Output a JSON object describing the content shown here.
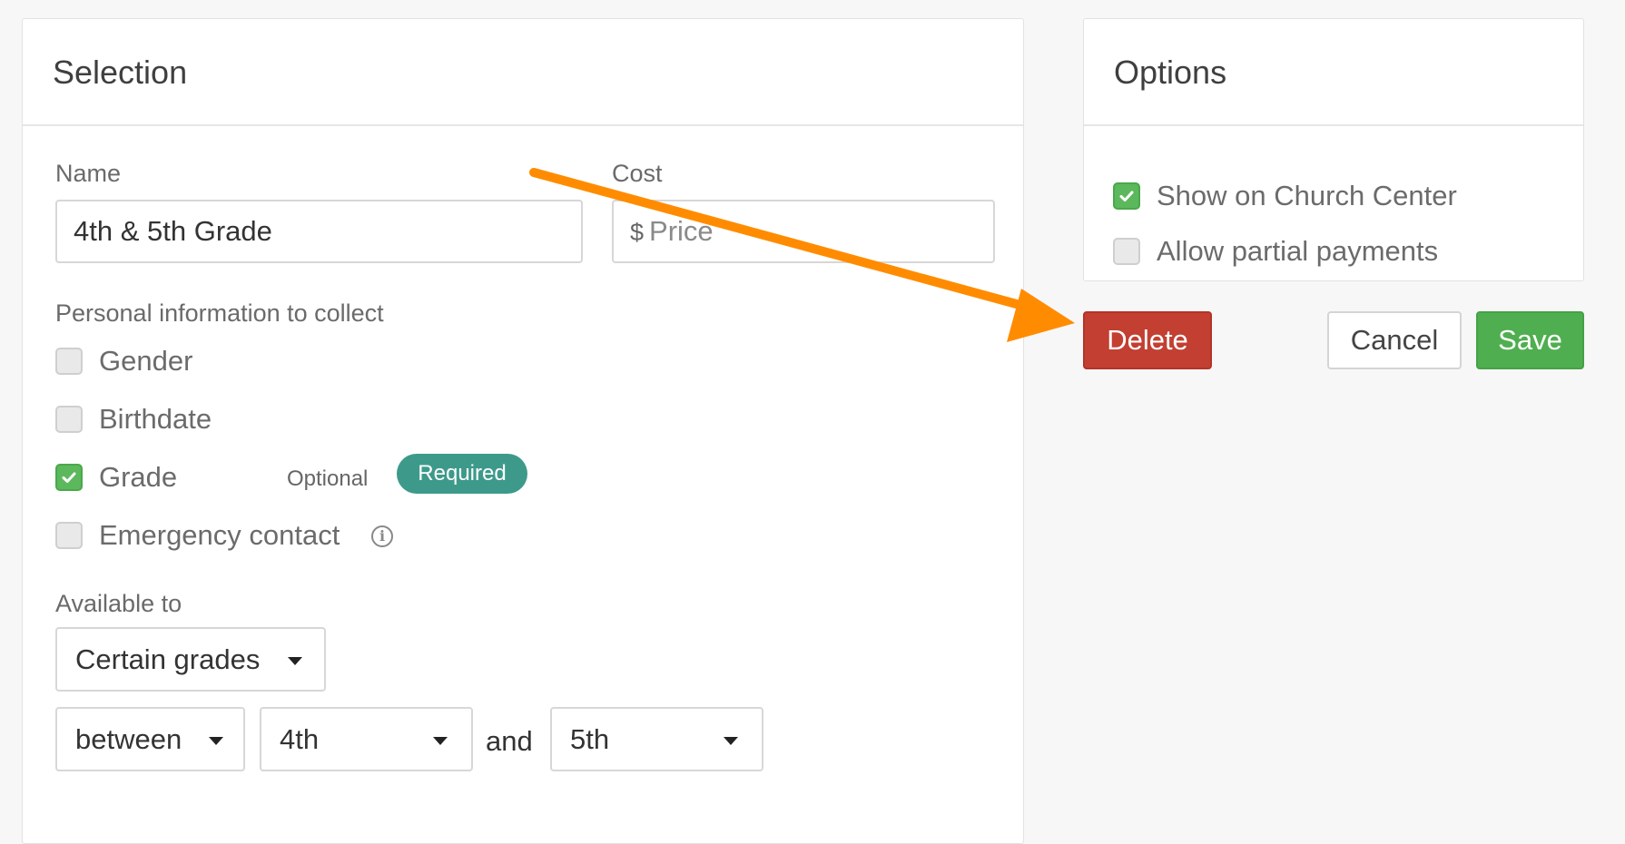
{
  "selection": {
    "title": "Selection",
    "name_label": "Name",
    "name_value": "4th & 5th Grade",
    "cost_label": "Cost",
    "cost_currency": "$",
    "cost_placeholder": "Price",
    "personal_info_label": "Personal information to collect",
    "fields": [
      {
        "label": "Gender",
        "checked": false
      },
      {
        "label": "Birthdate",
        "checked": false
      },
      {
        "label": "Grade",
        "checked": true
      },
      {
        "label": "Emergency contact",
        "checked": false
      }
    ],
    "grade_optional_label": "Optional",
    "grade_required_label": "Required",
    "available_to_label": "Available to",
    "available_to_value": "Certain grades",
    "range_operator": "between",
    "range_from": "4th",
    "range_and": "and",
    "range_to": "5th"
  },
  "options": {
    "title": "Options",
    "items": [
      {
        "label": "Show on Church Center",
        "checked": true
      },
      {
        "label": "Allow partial payments",
        "checked": false
      }
    ]
  },
  "actions": {
    "delete_label": "Delete",
    "cancel_label": "Cancel",
    "save_label": "Save"
  },
  "colors": {
    "accent_green": "#4fae4f",
    "danger_red": "#c23f32",
    "pill_teal": "#3d9a8b",
    "annotation_arrow": "#ff8c00"
  }
}
